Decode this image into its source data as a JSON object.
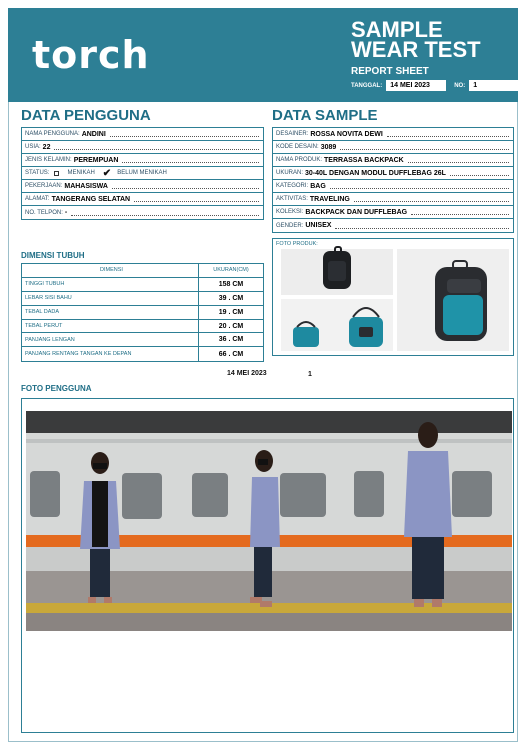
{
  "header": {
    "logo": "torch",
    "title_line1": "SAMPLE",
    "title_line2": "WEAR TEST",
    "subtitle": "REPORT SHEET",
    "date_label": "TANGGAL:",
    "date_value": "14 MEI 2023",
    "no_label": "NO:",
    "no_value": "1"
  },
  "data_pengguna": {
    "title": "DATA PENGGUNA",
    "rows": [
      {
        "label": "NAMA PENGGUNA:",
        "value": "ANDINI"
      },
      {
        "label": "USIA:",
        "value": "22"
      },
      {
        "label": "JENIS KELAMIN:",
        "value": "PEREMPUAN"
      },
      {
        "label": "STATUS:",
        "opt1": "MENIKAH",
        "opt2": "BELUM MENIKAH"
      },
      {
        "label": "PEKERJAAN:",
        "value": "MAHASISWA"
      },
      {
        "label": "ALAMAT:",
        "value": "TANGERANG SELATAN"
      },
      {
        "label": "NO. TELPON:",
        "value": "-"
      }
    ]
  },
  "data_sample": {
    "title": "DATA SAMPLE",
    "rows": [
      {
        "label": "DESAINER:",
        "value": "ROSSA NOVITA DEWI"
      },
      {
        "label": "KODE DESAIN:",
        "value": "3089"
      },
      {
        "label": "NAMA PRODUK:",
        "value": "TERRASSA BACKPACK"
      },
      {
        "label": "UKURAN:",
        "value": "30-40L DENGAN MODUL DUFFLEBAG 26L"
      },
      {
        "label": "KATEGORI:",
        "value": "BAG"
      },
      {
        "label": "AKTIVITAS:",
        "value": "TRAVELING"
      },
      {
        "label": "KOLEKSI:",
        "value": "BACKPACK DAN DUFFLEBAG"
      },
      {
        "label": "GENDER:",
        "value": "UNISEX"
      }
    ],
    "foto_produk_label": "FOTO PRODUK:"
  },
  "dimensi_tubuh": {
    "title": "DIMENSI TUBUH",
    "header": {
      "col1": "DIMENSI",
      "col2": "UKURAN(CM)"
    },
    "rows": [
      {
        "label": "TINGGI TUBUH",
        "value": "158 CM"
      },
      {
        "label": "LEBAR SISI BAHU",
        "value": "39 . CM"
      },
      {
        "label": "TEBAL DADA",
        "value": "19 . CM"
      },
      {
        "label": "TEBAL PERUT",
        "value": "20 . CM"
      },
      {
        "label": "PANJANG LENGAN",
        "value": "36 . CM"
      },
      {
        "label": "PANJANG RENTANG TANGAN KE DEPAN",
        "value": "66 . CM"
      }
    ]
  },
  "footer_meta": {
    "date": "14 MEI 2023",
    "no": "1"
  },
  "foto_pengguna": {
    "title": "FOTO PENGGUNA"
  },
  "colors": {
    "brand": "#2d7f95",
    "accent_title": "#1f6e86",
    "stripe": "#e46a1e"
  }
}
